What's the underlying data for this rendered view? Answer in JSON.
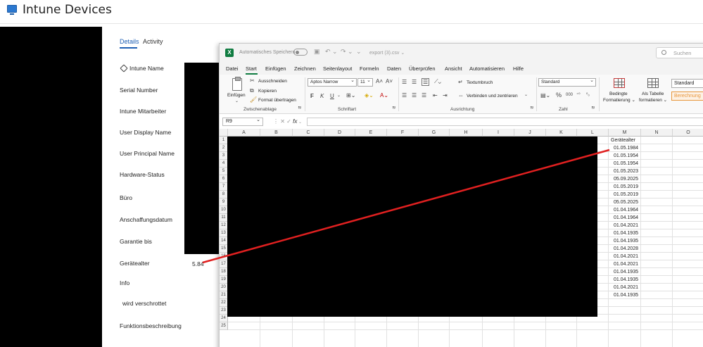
{
  "intune": {
    "title": "Intune Devices",
    "tabs": [
      "Details",
      "Activity"
    ],
    "properties": [
      "Intune Name",
      "Serial Number",
      "Intune Mitarbeiter",
      "User Display Name",
      "User Principal Name",
      "Hardware-Status",
      "Büro",
      "Anschaffungsdatum",
      "Garantie bis",
      "Gerätealter",
      "Info",
      "wird verschrottet",
      "Funktionsbeschreibung"
    ],
    "geraetealter_value": "5.84"
  },
  "excel": {
    "autosave_label": "Automatisches Speichern",
    "filename": "export (3).csv ⌄",
    "search_placeholder": "Suchen",
    "menu": [
      "Datei",
      "Start",
      "Einfügen",
      "Zeichnen",
      "Seitenlayout",
      "Formeln",
      "Daten",
      "Überprüfen",
      "Ansicht",
      "Automatisieren",
      "Hilfe"
    ],
    "ribbon": {
      "paste": "Einfügen",
      "cut": "Ausschneiden",
      "copy": "Kopieren",
      "format_painter": "Format übertragen",
      "group_clipboard": "Zwischenablage",
      "font_name": "Aptos Narrow",
      "font_size": "11",
      "bold": "F",
      "italic": "K",
      "underline": "U",
      "group_font": "Schriftart",
      "wrap_text": "Textumbruch",
      "merge_center": "Verbinden und zentrieren",
      "group_alignment": "Ausrichtung",
      "number_format": "Standard",
      "group_number": "Zahl",
      "conditional_formatting_1": "Bedingte",
      "conditional_formatting_2": "Formatierung ⌄",
      "format_table_1": "Als Tabelle",
      "format_table_2": "formatieren ⌄",
      "style_standard": "Standard",
      "style_calc": "Berechnung"
    },
    "namebox": "R9",
    "fx_label": "fx",
    "columns": [
      "A",
      "B",
      "C",
      "D",
      "E",
      "F",
      "G",
      "H",
      "I",
      "J",
      "K",
      "L",
      "M",
      "N",
      "O"
    ],
    "rows": [
      "1",
      "2",
      "3",
      "4",
      "5",
      "6",
      "7",
      "8",
      "9",
      "10",
      "11",
      "12",
      "13",
      "14",
      "15",
      "16",
      "17",
      "18",
      "19",
      "20",
      "21",
      "22",
      "23",
      "24",
      "25"
    ],
    "column_m_header": "Gerätealter",
    "column_m_values": [
      "01.05.1984",
      "01.05.1954",
      "01.05.1954",
      "01.05.2023",
      "05.09.2025",
      "01.05.2019",
      "01.05.2019",
      "05.05.2025",
      "01.04.1964",
      "01.04.1964",
      "01.04.2021",
      "01.04.1935",
      "01.04.1935",
      "01.04.2028",
      "01.04.2021",
      "01.04.2021",
      "01.04.1935",
      "01.04.1935",
      "01.04.2021",
      "01.04.1935"
    ]
  },
  "colors": {
    "excel_green": "#107c41",
    "annotation_red": "#e02020",
    "link_blue": "#1f5fb3"
  }
}
